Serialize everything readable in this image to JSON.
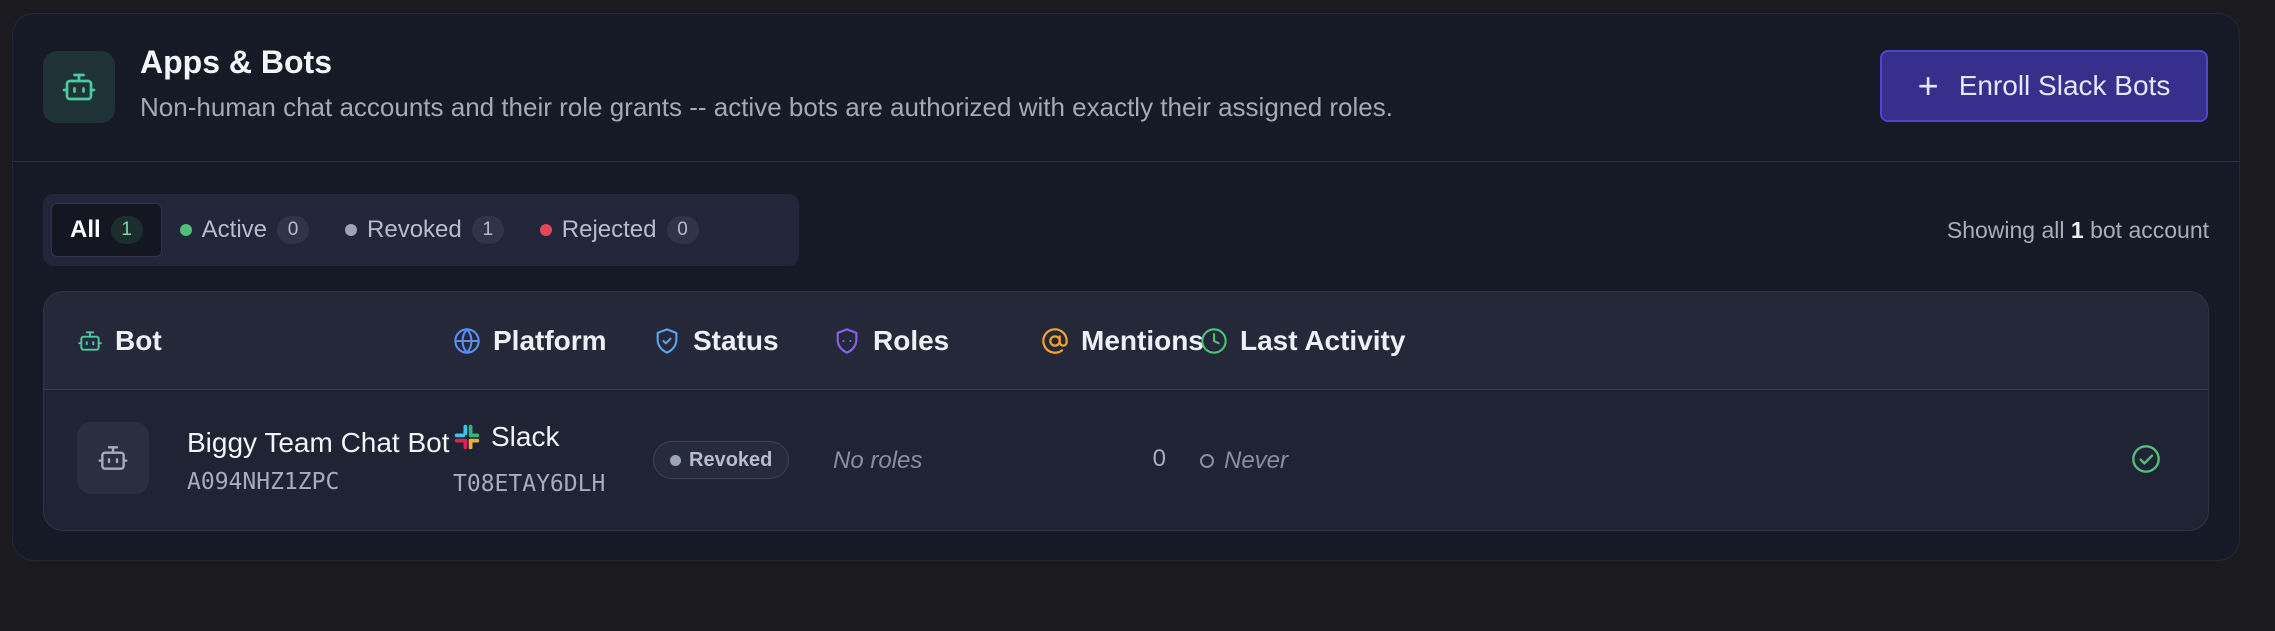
{
  "header": {
    "title": "Apps & Bots",
    "subtitle": "Non-human chat accounts and their role grants -- active bots are authorized with exactly their assigned roles.",
    "icon": "robot-icon",
    "enroll_label": "Enroll Slack Bots",
    "enroll_icon": "plus-icon"
  },
  "filters": {
    "tabs": [
      {
        "label": "All",
        "count": "1",
        "selected": true
      },
      {
        "label": "Active",
        "count": "0",
        "dot_color": "#4fbf7a"
      },
      {
        "label": "Revoked",
        "count": "1",
        "dot_color": "#9ea4b8"
      },
      {
        "label": "Rejected",
        "count": "0",
        "dot_color": "#e2465c"
      }
    ],
    "showing_prefix": "Showing all",
    "showing_count": "1",
    "showing_suffix": "bot account"
  },
  "table": {
    "columns": [
      {
        "label": "Bot",
        "icon": "robot-icon",
        "color": "#4cc9a0"
      },
      {
        "label": "Platform",
        "icon": "globe-icon",
        "color": "#5b8ef0"
      },
      {
        "label": "Status",
        "icon": "shield-check-icon",
        "color": "#5ba2f0"
      },
      {
        "label": "Roles",
        "icon": "shield-icon",
        "color": "#8b62f0"
      },
      {
        "label": "Mentions",
        "icon": "at-icon",
        "color": "#f0a530"
      },
      {
        "label": "Last Activity",
        "icon": "clock-icon",
        "color": "#4fbf7a"
      }
    ],
    "rows": [
      {
        "bot_name": "Biggy Team Chat Bot",
        "bot_id": "A094NHZ1ZPC",
        "platform": "Slack",
        "platform_icon": "slack-icon",
        "platform_id": "T08ETAY6DLH",
        "status": "Revoked",
        "roles": "No roles",
        "mentions": "0",
        "last_activity": "Never",
        "action_icon": "check-circle-icon"
      }
    ]
  },
  "colors": {
    "accent": "#4f46c8",
    "success": "#4fbf7a",
    "card_bg": "#161a26"
  }
}
